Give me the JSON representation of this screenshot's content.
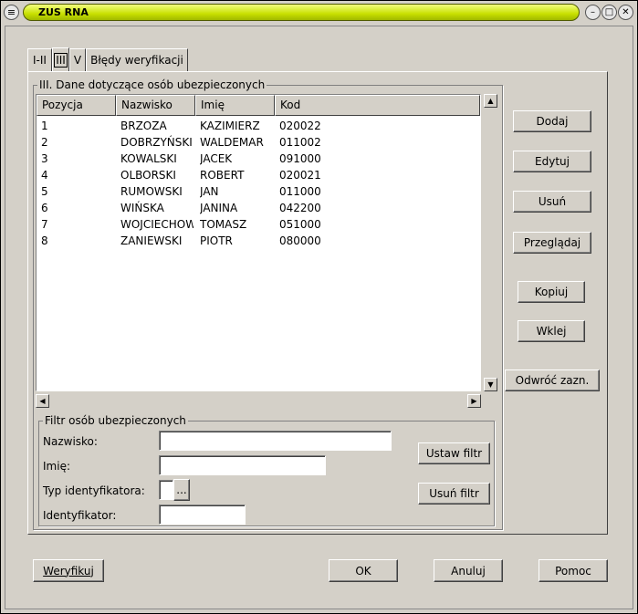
{
  "window": {
    "title": "ZUS RNA"
  },
  "tabs": [
    {
      "label": "I-II"
    },
    {
      "label": "III"
    },
    {
      "label": "V"
    },
    {
      "label": "Błędy weryfikacji"
    }
  ],
  "section": {
    "title": "III. Dane dotyczące osób ubezpieczonych"
  },
  "table": {
    "columns": [
      "Pozycja",
      "Nazwisko",
      "Imię",
      "Kod"
    ],
    "rows": [
      [
        "1",
        "BRZOZA",
        "KAZIMIERZ",
        "020022"
      ],
      [
        "2",
        "DOBRZYŃSKI",
        "WALDEMAR",
        "011002"
      ],
      [
        "3",
        "KOWALSKI",
        "JACEK",
        "091000"
      ],
      [
        "4",
        "OLBORSKI",
        "ROBERT",
        "020021"
      ],
      [
        "5",
        "RUMOWSKI",
        "JAN",
        "011000"
      ],
      [
        "6",
        "WIŃSKA",
        "JANINA",
        "042200"
      ],
      [
        "7",
        "WOJCIECHOWSKI",
        "TOMASZ",
        "051000"
      ],
      [
        "8",
        "ZANIEWSKI",
        "PIOTR",
        "080000"
      ]
    ]
  },
  "side_buttons": {
    "add": "Dodaj",
    "edit": "Edytuj",
    "delete": "Usuń",
    "browse": "Przeglądaj",
    "copy": "Kopiuj",
    "paste": "Wklej",
    "invert": "Odwróć zazn."
  },
  "filter": {
    "title": "Filtr osób ubezpieczonych",
    "surname_label": "Nazwisko:",
    "name_label": "Imię:",
    "id_type_label": "Typ identyfikatora:",
    "id_label": "Identyfikator:",
    "browse_label": "...",
    "set_filter": "Ustaw filtr",
    "clear_filter": "Usuń filtr"
  },
  "footer": {
    "verify": "Weryfikuj",
    "ok": "OK",
    "cancel": "Anuluj",
    "help": "Pomoc"
  }
}
